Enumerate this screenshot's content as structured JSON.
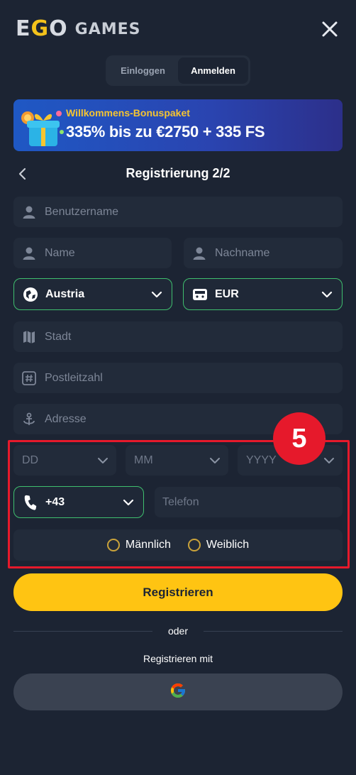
{
  "header": {
    "logo_ego": [
      "E",
      "G",
      "O"
    ],
    "logo_games": "GAMES",
    "close_icon": "close-icon"
  },
  "auth_tabs": {
    "login": "Einloggen",
    "register": "Anmelden"
  },
  "banner": {
    "title": "Willkommens-Bonuspaket",
    "offer": "335% bis zu €2750 + 335 FS"
  },
  "step": {
    "title": "Registrierung  2/2"
  },
  "form": {
    "username_placeholder": "Benutzername",
    "name_placeholder": "Name",
    "surname_placeholder": "Nachname",
    "country": "Austria",
    "currency": "EUR",
    "city_placeholder": "Stadt",
    "zip_placeholder": "Postleitzahl",
    "address_placeholder": "Adresse",
    "day_placeholder": "DD",
    "month_placeholder": "MM",
    "year_placeholder": "YYYY",
    "phone_code": "+43",
    "phone_placeholder": "Telefon",
    "gender_male": "Männlich",
    "gender_female": "Weiblich"
  },
  "annotation": {
    "step_number": "5"
  },
  "actions": {
    "submit": "Registrieren",
    "or": "oder",
    "register_with": "Registrieren mit"
  },
  "colors": {
    "background": "#1c2433",
    "accent_yellow": "#ffc412",
    "select_border": "#3fbf6e",
    "highlight_red": "#e6192b"
  }
}
